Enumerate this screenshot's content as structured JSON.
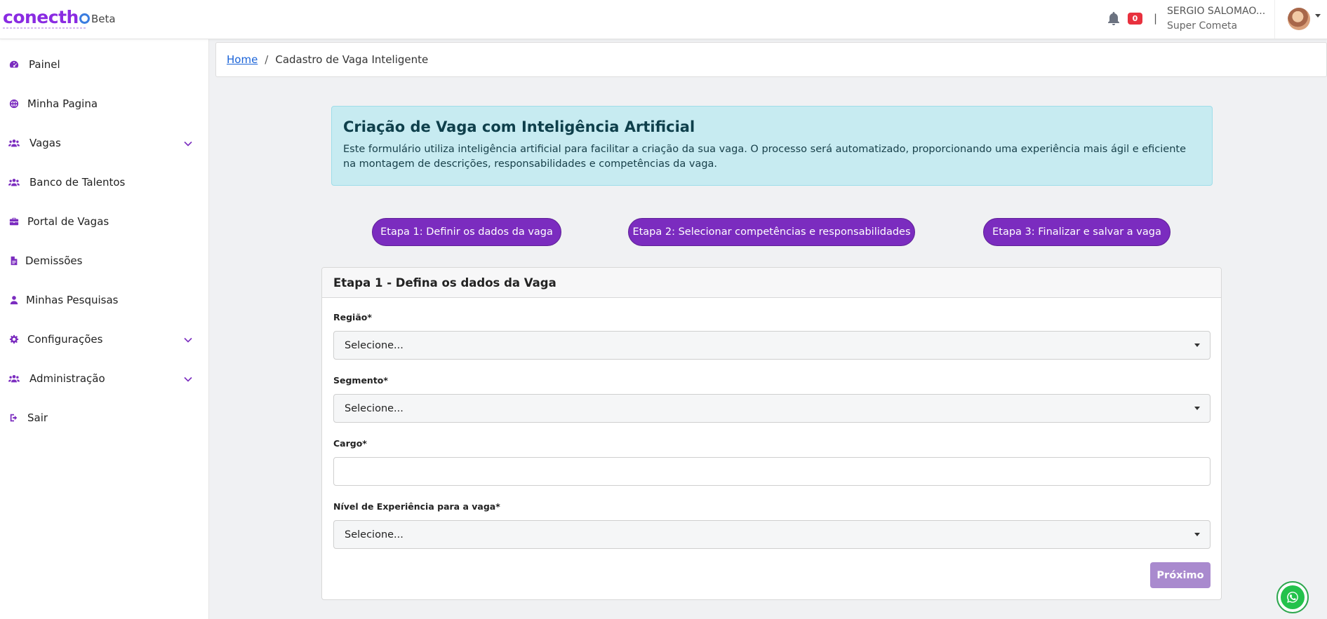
{
  "header": {
    "logo_text": "conecth",
    "logo_suffix": "i",
    "beta_label": "Beta",
    "notification_count": "0",
    "separator": "|",
    "user_name": "SERGIO SALOMAO...",
    "user_company": "Super Cometa"
  },
  "sidebar": {
    "items": [
      {
        "label": "Painel",
        "icon": "gauge-icon"
      },
      {
        "label": "Minha Pagina",
        "icon": "globe-icon"
      },
      {
        "label": "Vagas",
        "icon": "users-icon",
        "expandable": true
      },
      {
        "label": "Banco de Talentos",
        "icon": "users-icon"
      },
      {
        "label": "Portal de Vagas",
        "icon": "briefcase-icon"
      },
      {
        "label": "Demissões",
        "icon": "file-icon"
      },
      {
        "label": "Minhas Pesquisas",
        "icon": "user-icon"
      },
      {
        "label": "Configurações",
        "icon": "gear-icon",
        "expandable": true
      },
      {
        "label": "Administração",
        "icon": "users-icon",
        "expandable": true
      },
      {
        "label": "Sair",
        "icon": "sign-out-icon"
      }
    ]
  },
  "breadcrumb": {
    "home": "Home",
    "separator": "/",
    "current": "Cadastro de Vaga Inteligente"
  },
  "banner": {
    "title": "Criação de Vaga com Inteligência Artificial",
    "text": "Este formulário utiliza inteligência artificial para facilitar a criação da sua vaga. O processo será automatizado, proporcionando uma experiência mais ágil e eficiente na montagem de descrições, responsabilidades e competências da vaga."
  },
  "steps": [
    "Etapa 1: Definir os dados da vaga",
    "Etapa 2: Selecionar competências e responsabilidades",
    "Etapa 3: Finalizar e salvar a vaga"
  ],
  "form": {
    "title": "Etapa 1 - Defina os dados da Vaga",
    "regiao_label": "Região*",
    "regiao_value": "Selecione...",
    "segmento_label": "Segmento*",
    "segmento_value": "Selecione...",
    "cargo_label": "Cargo*",
    "cargo_value": "",
    "nivel_label": "Nível de Experiência para a vaga*",
    "nivel_value": "Selecione...",
    "next_label": "Próximo"
  },
  "colors": {
    "brand_purple": "#7b2cbf",
    "banner_bg": "#c7ebf1",
    "badge_red": "#e8313e",
    "whatsapp_green": "#23c24b"
  }
}
